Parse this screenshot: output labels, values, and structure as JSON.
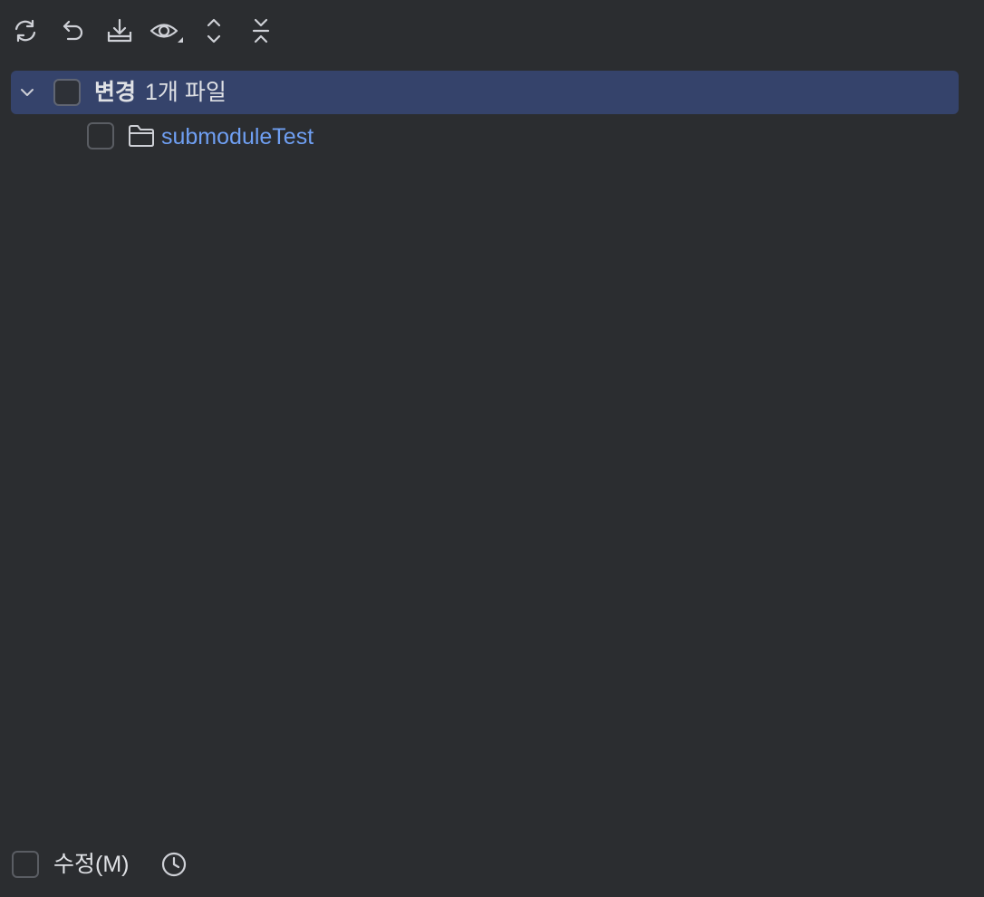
{
  "toolbar": {
    "buttons": [
      {
        "icon": "refresh-icon"
      },
      {
        "icon": "rollback-icon"
      },
      {
        "icon": "shelve-icon"
      },
      {
        "icon": "view-options-icon"
      },
      {
        "icon": "expand-all-icon"
      },
      {
        "icon": "collapse-all-icon"
      }
    ]
  },
  "tree": {
    "root": {
      "title": "변경",
      "count": "1개 파일",
      "expanded": true,
      "checked": false
    },
    "children": [
      {
        "label": "submoduleTest",
        "icon": "folder-icon",
        "checked": false
      }
    ]
  },
  "bottom": {
    "amend_label": "수정(M)",
    "amend_checked": false,
    "history_icon": "clock-icon"
  },
  "colors": {
    "background": "#2b2d30",
    "selection": "#35436b",
    "link_text": "#6f9ff2",
    "text": "#dfe1e5"
  }
}
